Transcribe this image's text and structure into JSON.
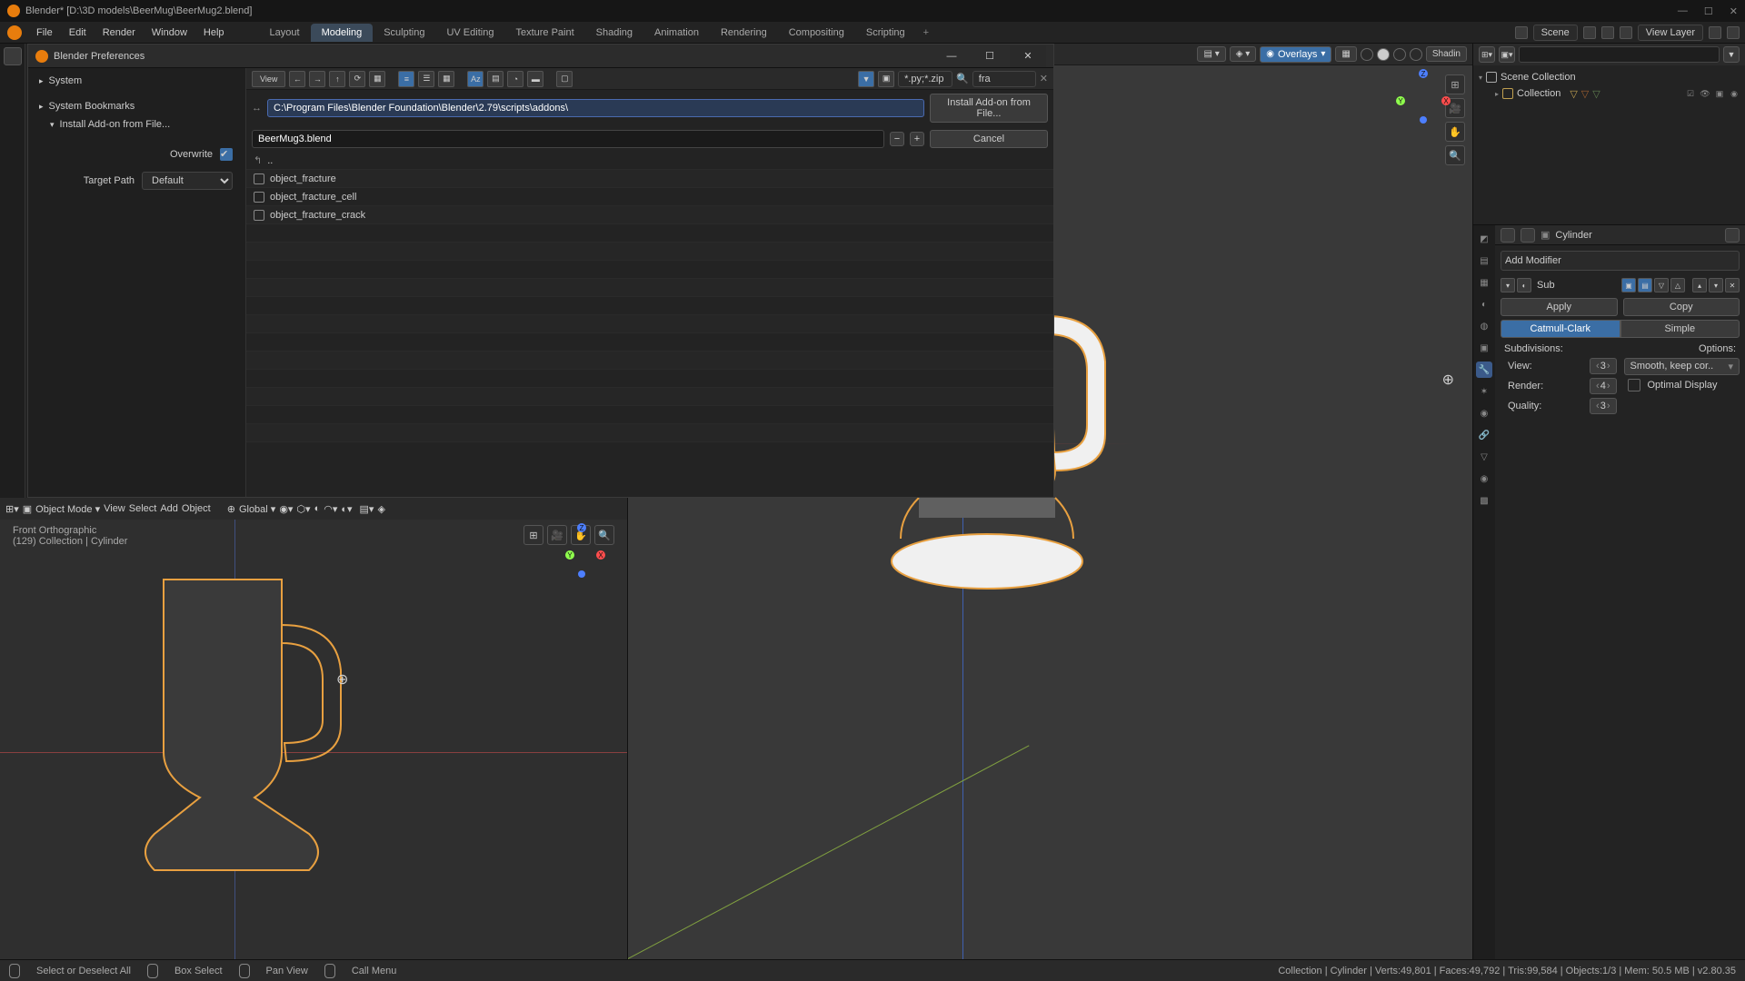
{
  "title": "Blender* [D:\\3D models\\BeerMug\\BeerMug2.blend]",
  "window_controls": {
    "min": "—",
    "max": "☐",
    "close": "✕"
  },
  "menubar": {
    "items": [
      "File",
      "Edit",
      "Render",
      "Window",
      "Help"
    ],
    "tabs": [
      "Layout",
      "Modeling",
      "Sculpting",
      "UV Editing",
      "Texture Paint",
      "Shading",
      "Animation",
      "Rendering",
      "Compositing",
      "Scripting"
    ],
    "active_tab": 1,
    "scene_label": "Scene",
    "viewlayer_label": "View Layer"
  },
  "prefs": {
    "title": "Blender Preferences",
    "view_btn": "View",
    "side": {
      "system": "System",
      "bookmarks": "System Bookmarks",
      "install": "Install Add-on from File...",
      "overwrite_label": "Overwrite",
      "targetpath_label": "Target Path",
      "targetpath_value": "Default"
    },
    "path": "C:\\Program Files\\Blender Foundation\\Blender\\2.79\\scripts\\addons\\",
    "filename": "BeerMug3.blend",
    "filter_ext": "*.py;*.zip",
    "search": "fra",
    "search_placeholder": "",
    "install_btn": "Install Add-on from File...",
    "cancel_btn": "Cancel",
    "files": [
      {
        "name": "..",
        "icon": "up"
      },
      {
        "name": "object_fracture",
        "icon": "folder"
      },
      {
        "name": "object_fracture_cell",
        "icon": "folder"
      },
      {
        "name": "object_fracture_crack",
        "icon": "folder"
      }
    ]
  },
  "viewport_main": {
    "overlays": "Overlays",
    "shading_label": "Shadin"
  },
  "viewport_left": {
    "mode": "Object Mode",
    "menus": [
      "View",
      "Select",
      "Add",
      "Object"
    ],
    "orient": "Global",
    "label_top": "Front Orthographic",
    "label_sub": "(129) Collection | Cylinder"
  },
  "outliner": {
    "scene_collection": "Scene Collection",
    "collection": "Collection"
  },
  "properties": {
    "breadcrumb": "Cylinder",
    "add_modifier": "Add Modifier",
    "modifier_name": "Sub",
    "apply": "Apply",
    "copy": "Copy",
    "catmull": "Catmull-Clark",
    "simple": "Simple",
    "subdiv_label": "Subdivisions:",
    "options_label": "Options:",
    "view_label": "View:",
    "view_val": "3",
    "render_label": "Render:",
    "render_val": "4",
    "quality_label": "Quality:",
    "quality_val": "3",
    "uv_smooth": "Smooth, keep cor..",
    "optimal": "Optimal Display"
  },
  "statusbar": {
    "left": [
      "Select or Deselect All",
      "Box Select",
      "Pan View",
      "Call Menu"
    ],
    "right": "Collection | Cylinder | Verts:49,801 | Faces:49,792 | Tris:99,584 | Objects:1/3 | Mem: 50.5 MB | v2.80.35"
  }
}
